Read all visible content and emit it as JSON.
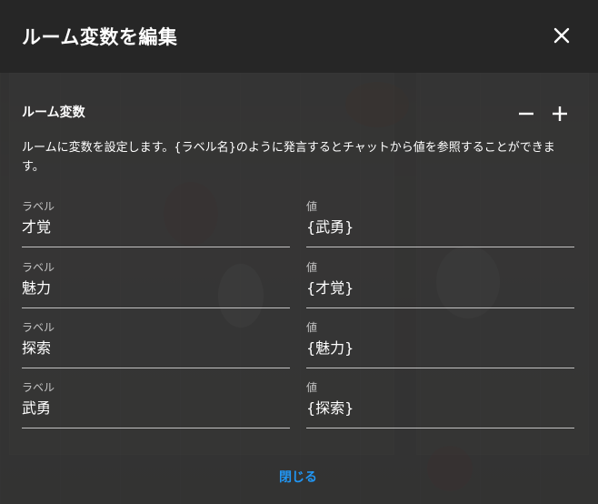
{
  "dialog": {
    "title": "ルーム変数を編集",
    "close_icon": "close-icon",
    "section_title": "ルーム変数",
    "remove_icon": "minus-icon",
    "add_icon": "plus-icon",
    "description": "ルームに変数を設定します。{ラベル名}のように発言するとチャットから値を参照することができます。",
    "variables": [
      {
        "label_caption": "ラベル",
        "label": "才覚",
        "value_caption": "値",
        "value": "{武勇}"
      },
      {
        "label_caption": "ラベル",
        "label": "魅力",
        "value_caption": "値",
        "value": "{才覚}"
      },
      {
        "label_caption": "ラベル",
        "label": "探索",
        "value_caption": "値",
        "value": "{魅力}"
      },
      {
        "label_caption": "ラベル",
        "label": "武勇",
        "value_caption": "値",
        "value": "{探索}"
      }
    ],
    "close_label": "閉じる"
  },
  "colors": {
    "header_bg": "#262626",
    "accent": "#2196f3"
  }
}
